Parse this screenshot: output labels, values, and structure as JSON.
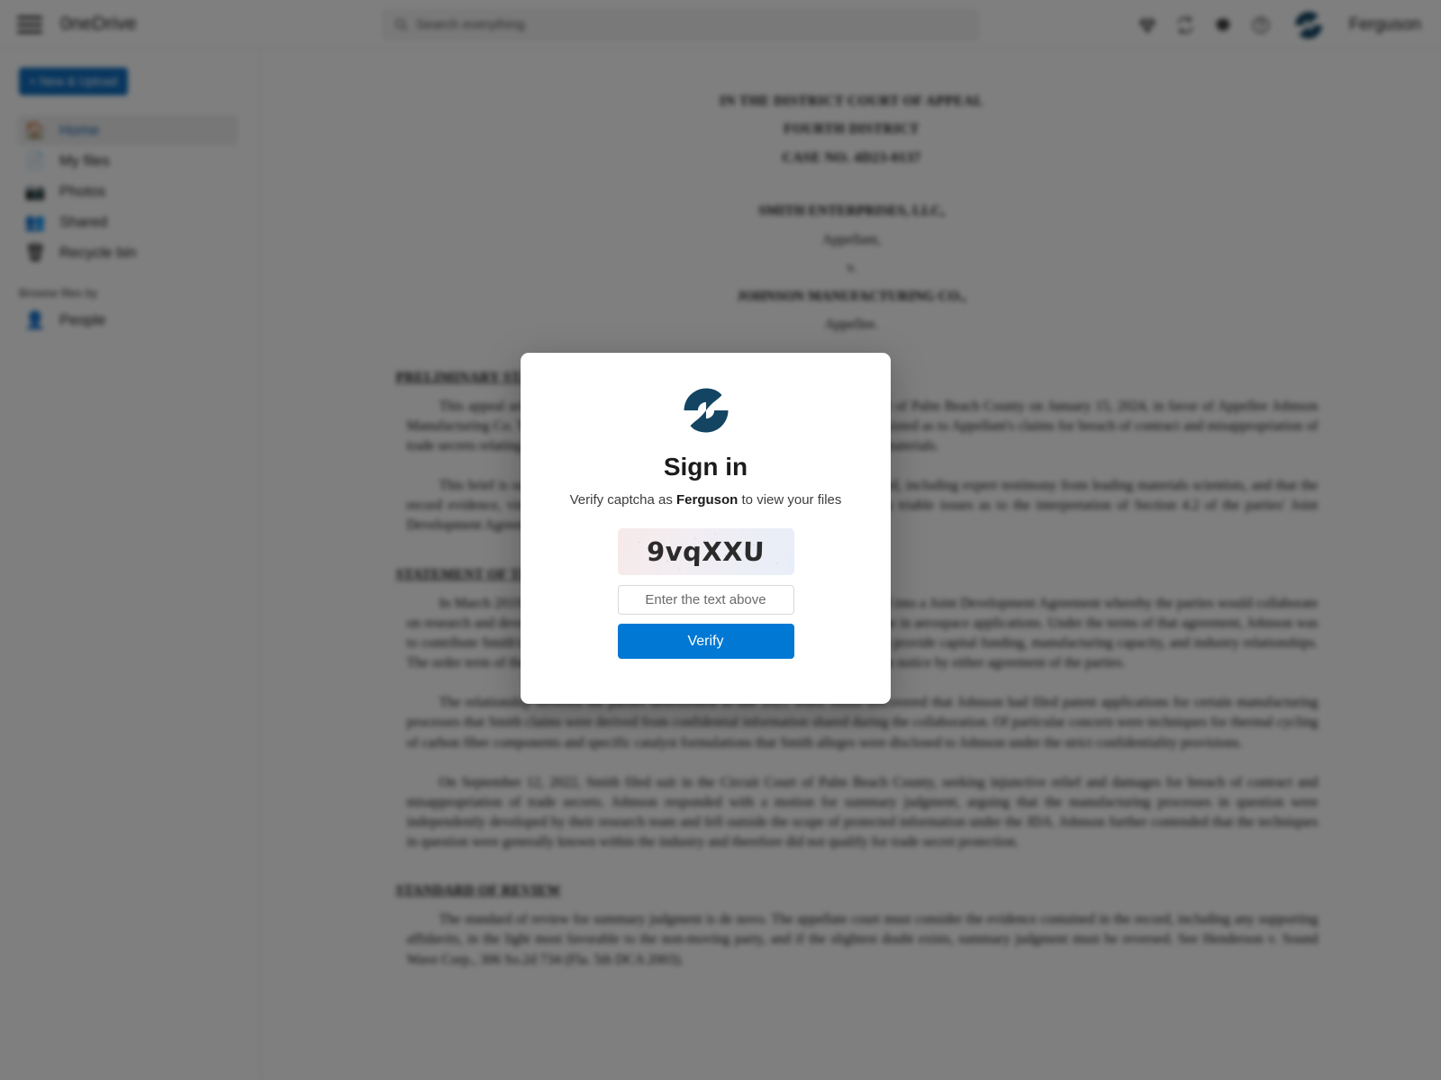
{
  "header": {
    "menu_icon": "hamburger-icon",
    "brand": "0neDrive",
    "search": {
      "placeholder": "Search everything",
      "value": "",
      "icon": "search-icon"
    },
    "icons": [
      {
        "name": "diamond-premium-icon"
      },
      {
        "name": "sync-refresh-icon"
      },
      {
        "name": "gear-settings-icon"
      },
      {
        "name": "help-circle-icon"
      }
    ],
    "account": {
      "avatar_icon": "brand-logo-avatar",
      "name": "Ferguson"
    }
  },
  "sidebar": {
    "new_upload_label": "+ New & Upload",
    "items": [
      {
        "label": "Home",
        "icon": "🏠",
        "icon_name": "home-icon",
        "active": true
      },
      {
        "label": "My files",
        "icon": "📄",
        "icon_name": "document-icon",
        "active": false
      },
      {
        "label": "Photos",
        "icon": "📷",
        "icon_name": "camera-icon",
        "active": false
      },
      {
        "label": "Shared",
        "icon": "👥",
        "icon_name": "people-icon",
        "active": false
      },
      {
        "label": "Recycle bin",
        "icon": "🗑",
        "icon_name": "trash-icon",
        "active": false
      }
    ],
    "browse_heading": "Browse files by",
    "browse_items": [
      {
        "label": "People",
        "icon": "👤",
        "icon_name": "person-icon"
      }
    ]
  },
  "document": {
    "court_lines": [
      "IN THE DISTRICT COURT OF APPEAL",
      "FOURTH DISTRICT",
      "CASE NO. 4D23-0137"
    ],
    "parties": [
      {
        "text": "SMITH ENTERPRISES, LLC,",
        "bold": true
      },
      {
        "text": "Appellant,",
        "bold": false
      },
      {
        "text": "v.",
        "bold": false
      },
      {
        "text": "JOHNSON MANUFACTURING CO.,",
        "bold": true
      },
      {
        "text": "Appellee.",
        "bold": false
      }
    ],
    "sections": [
      {
        "heading": "PRELIMINARY STATEMENT",
        "paragraphs": [
          "This appeal arises from a final summary judgment entered by the Circuit Court of Palm Beach County on January 15, 2024, in favor of Appellee Johnson Manufacturing Co. The trial court determined that no genuine issue of material fact existed as to Appellant's claims for breach of contract and misappropriation of trade secrets relating to proprietary manufacturing processes for advanced composite materials.",
          "This brief is submitted in support of Appellant's position that the trial court erred, including expert testimony from leading materials scientists, and that the record evidence, viewed in the light most favorable to the nonmoving party, raises triable issues as to the interpretation of Section 4.2 of the parties' Joint Development Agreement and the scope of protected information thereunder."
        ]
      },
      {
        "heading": "STATEMENT OF THE CASE AND FACTS",
        "paragraphs": [
          "In March 2019, Smith Enterprises, LLC and Johnson Manufacturing Co. entered into a Joint Development Agreement whereby the parties would collaborate on research and development activities involving advanced composite materials for use in aerospace applications. Under the terms of that agreement, Johnson was to contribute Smith's proprietary carbon fiber formulation processes and Smith was to provide capital funding, manufacturing capacity, and industry relationships. The order term of the agreement was three years with automatic renewal absent written notice by either agreement of the parties.",
          "The relationship between the parties deteriorated in late 2021 when Smith discovered that Johnson had filed patent applications for certain manufacturing processes that Smith claims were derived from confidential information shared during the collaboration. Of particular concern were techniques for thermal cycling of carbon fiber components and specific catalyst formulations that Smith alleges were disclosed to Johnson under the strict confidentiality provisions.",
          "On September 12, 2022, Smith filed suit in the Circuit Court of Palm Beach County, seeking injunctive relief and damages for breach of contract and misappropriation of trade secrets. Johnson responded with a motion for summary judgment, arguing that the manufacturing processes in question were independently developed by their research team and fell outside the scope of protected information under the JDA. Johnson further contended that the techniques in question were generally known within the industry and therefore did not qualify for trade secret protection."
        ]
      },
      {
        "heading": "STANDARD OF REVIEW",
        "paragraphs": [
          "The standard of review for summary judgment is de novo. The appellate court must consider the evidence contained in the record, including any supporting affidavits, in the light most favorable to the non-moving party, and if the slightest doubt exists, summary judgment must be reversed. See Henderson v. Sound Wave Corp., 306 So.2d 734 (Fla. 5th DCA 2003)."
        ]
      }
    ]
  },
  "modal": {
    "logo_icon": "brand-logo",
    "title": "Sign in",
    "subtitle_before": "Verify captcha as ",
    "subtitle_user": "Ferguson",
    "subtitle_after": " to view your files",
    "captcha_text": "9vqXXU",
    "input_placeholder": "Enter the text above",
    "input_value": "",
    "verify_label": "Verify"
  },
  "colors": {
    "brand_navy": "#134563",
    "accent_blue": "#0078d4",
    "sidebar_button_blue": "#0f6cbd",
    "overlay": "rgba(0,0,0,0.50)"
  }
}
